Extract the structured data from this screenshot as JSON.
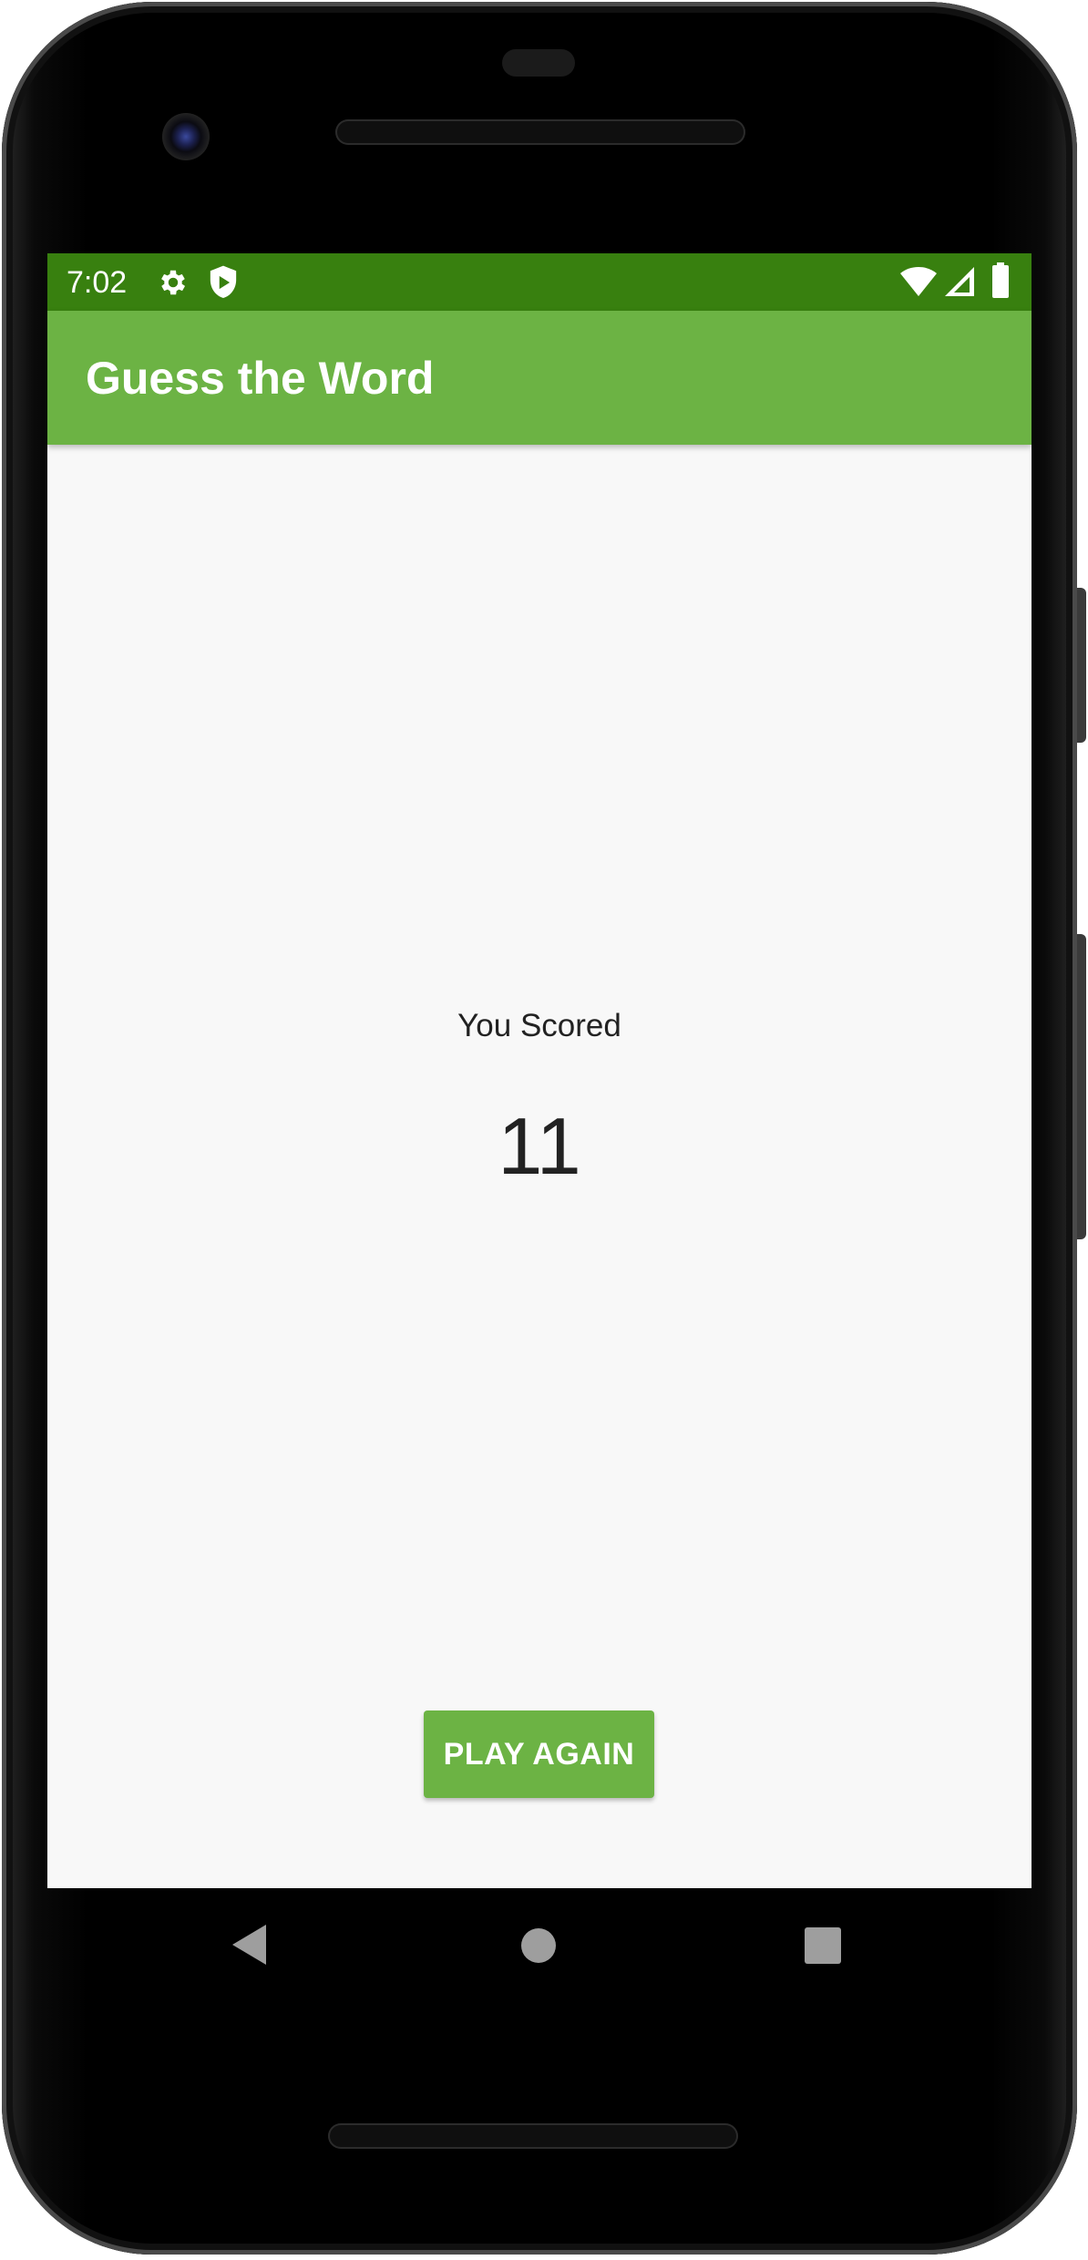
{
  "status_bar": {
    "time": "7:02",
    "left_icons": [
      "gear-icon",
      "shield-play-icon"
    ],
    "right_icons": [
      "wifi-icon",
      "cellular-signal-icon",
      "battery-icon"
    ],
    "color": "#38800f"
  },
  "app_bar": {
    "title": "Guess the Word",
    "color": "#6cb344"
  },
  "score": {
    "label": "You Scored",
    "value": "11"
  },
  "actions": {
    "play_again_label": "PLAY AGAIN"
  },
  "nav_bar": {
    "buttons": [
      "back-icon",
      "home-icon",
      "recents-icon"
    ]
  }
}
